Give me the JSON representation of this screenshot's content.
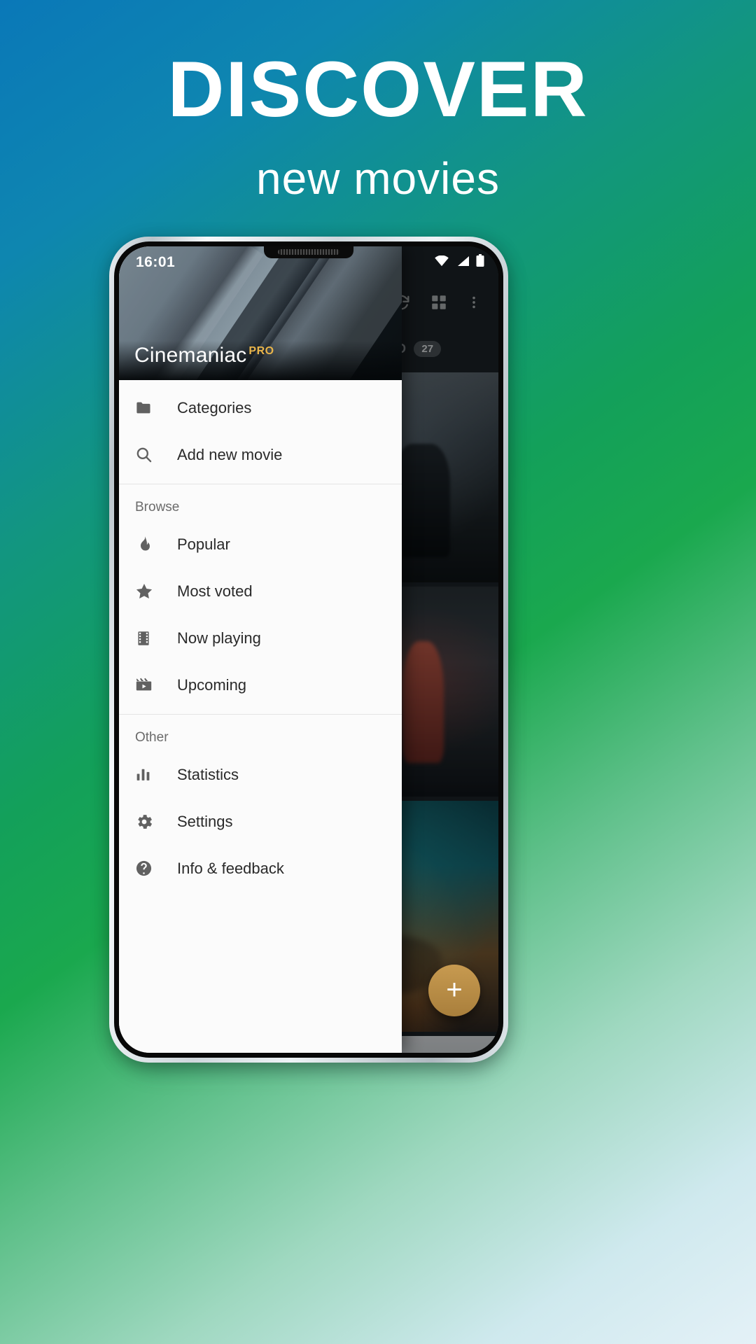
{
  "promo": {
    "title": "DISCOVER",
    "subtitle": "new movies",
    "bg_from": "#0a78b8",
    "bg_to": "#e4f1f7",
    "text_color": "#ffffff"
  },
  "phone": {
    "status_bar": {
      "time": "16:01",
      "icons": [
        "wifi-icon",
        "signal-icon",
        "battery-icon"
      ]
    }
  },
  "app": {
    "name": "Cinemaniac",
    "badge": "PRO",
    "accent_color": "#e8b44a",
    "toolbar": {
      "refresh_label": "refresh-icon",
      "grid_label": "grid-view-icon",
      "overflow_label": "more-vert-icon"
    },
    "tabs": [
      {
        "label": "WATCHED",
        "count": "27"
      }
    ],
    "fab": {
      "label": "+",
      "name": "add-movie-fab"
    }
  },
  "drawer": {
    "top_items": [
      {
        "label": "Categories",
        "icon": "folder-icon"
      },
      {
        "label": "Add new movie",
        "icon": "search-icon"
      }
    ],
    "sections": [
      {
        "title": "Browse",
        "items": [
          {
            "label": "Popular",
            "icon": "flame-icon"
          },
          {
            "label": "Most voted",
            "icon": "star-icon"
          },
          {
            "label": "Now playing",
            "icon": "film-strip-icon"
          },
          {
            "label": "Upcoming",
            "icon": "movie-clapper-icon"
          }
        ]
      },
      {
        "title": "Other",
        "items": [
          {
            "label": "Statistics",
            "icon": "bar-chart-icon"
          },
          {
            "label": "Settings",
            "icon": "gear-icon"
          },
          {
            "label": "Info & feedback",
            "icon": "help-circle-icon"
          }
        ]
      }
    ]
  }
}
